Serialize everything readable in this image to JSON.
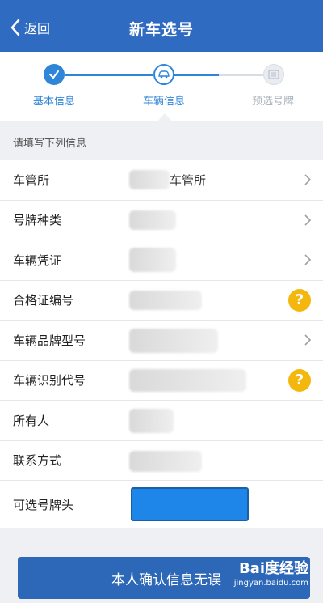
{
  "header": {
    "back_label": "返回",
    "title": "新车选号"
  },
  "steps": [
    {
      "label": "基本信息",
      "state": "done"
    },
    {
      "label": "车辆信息",
      "state": "active"
    },
    {
      "label": "预选号牌",
      "state": "pending"
    }
  ],
  "hint": "请填写下列信息",
  "fields": [
    {
      "label": "车管所",
      "value": "车管所",
      "accessory": "chevron"
    },
    {
      "label": "号牌种类",
      "value": "",
      "accessory": "chevron"
    },
    {
      "label": "车辆凭证",
      "value": "",
      "accessory": "chevron"
    },
    {
      "label": "合格证编号",
      "value": "",
      "accessory": "help"
    },
    {
      "label": "车辆品牌型号",
      "value": "",
      "accessory": "chevron"
    },
    {
      "label": "车辆识别代号",
      "value": "",
      "accessory": "help"
    },
    {
      "label": "所有人",
      "value": "",
      "accessory": "none"
    },
    {
      "label": "联系方式",
      "value": "",
      "accessory": "none"
    },
    {
      "label": "可选号牌头",
      "value": "",
      "accessory": "plate"
    }
  ],
  "help_symbol": "?",
  "confirm_label": "本人确认信息无误",
  "watermark": {
    "line1": "Bai度经验",
    "line2": "jingyan.baidu.com"
  },
  "colors": {
    "header": "#2f6bc0",
    "accent": "#2f86d9",
    "help": "#f4b70d",
    "plate": "#1e86e8"
  }
}
